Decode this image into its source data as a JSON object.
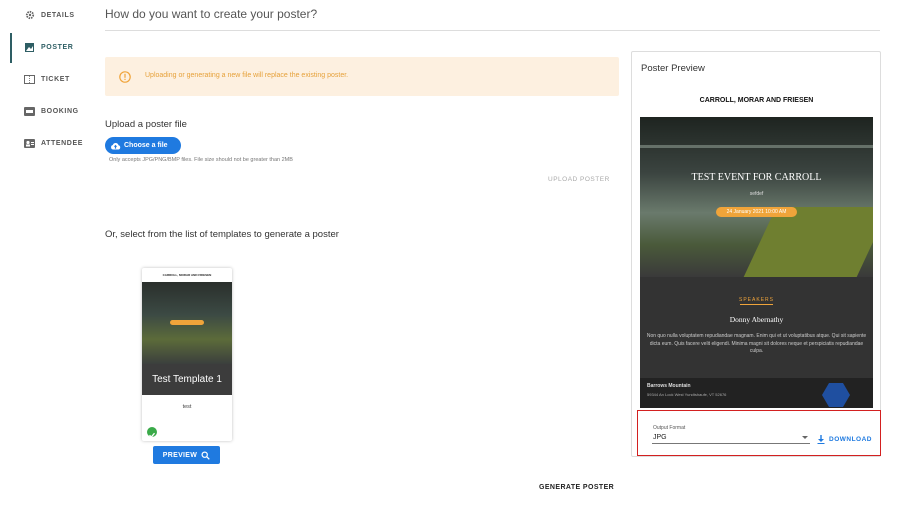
{
  "sidebar": {
    "items": [
      {
        "label": "DETAILS",
        "icon": "gear-icon"
      },
      {
        "label": "POSTER",
        "icon": "image-icon"
      },
      {
        "label": "TICKET",
        "icon": "ticket-icon"
      },
      {
        "label": "BOOKING",
        "icon": "booking-icon"
      },
      {
        "label": "ATTENDEE",
        "icon": "attendee-icon"
      }
    ],
    "active": "POSTER"
  },
  "main": {
    "question": "How do you want to create your poster?",
    "alert": "Uploading or generating a new file will replace the existing poster.",
    "upload_title": "Upload a poster file",
    "choose_label": "Choose a file",
    "upload_hint": "Only accepts JPG/PNG/BMP files. File size should not be greater than 2MB",
    "upload_button": "UPLOAD POSTER",
    "templates_title": "Or, select from the list of templates to generate a poster",
    "template": {
      "name": "Test Template 1",
      "description": "test",
      "selected": true
    },
    "preview_button": "PREVIEW",
    "generate_button": "GENERATE POSTER"
  },
  "preview": {
    "title": "Poster Preview",
    "org": "CARROLL, MORAR AND FRIESEN",
    "event_title": "TEST EVENT FOR CARROLL",
    "event_sub": "sefdef",
    "event_date": "24 January 2021 10:00 AM",
    "speakers_label": "SPEAKERS",
    "speaker_name": "Donny Abernathy",
    "speaker_bio": "Non quo nulla voluptatem repudiandae magnam. Enim qui et ut voluptatibus atque. Qui sit sapiente dicta eum. Quis facere velit eligendi. Minima magni sit dolores neque et perspiciatis repudiandae culpa.",
    "venue": "Barrows Mountain",
    "address": "59344 An Lock West Yundtshaufe, VT 52676",
    "output_format_label": "Output Format",
    "output_format_value": "JPG",
    "download_label": "DOWNLOAD"
  },
  "colors": {
    "accent": "#1f7ae0",
    "active_nav": "#2e5e64",
    "warning_bg": "#fdf0e0",
    "warning_text": "#e6a13a",
    "highlight": "#d32020"
  }
}
